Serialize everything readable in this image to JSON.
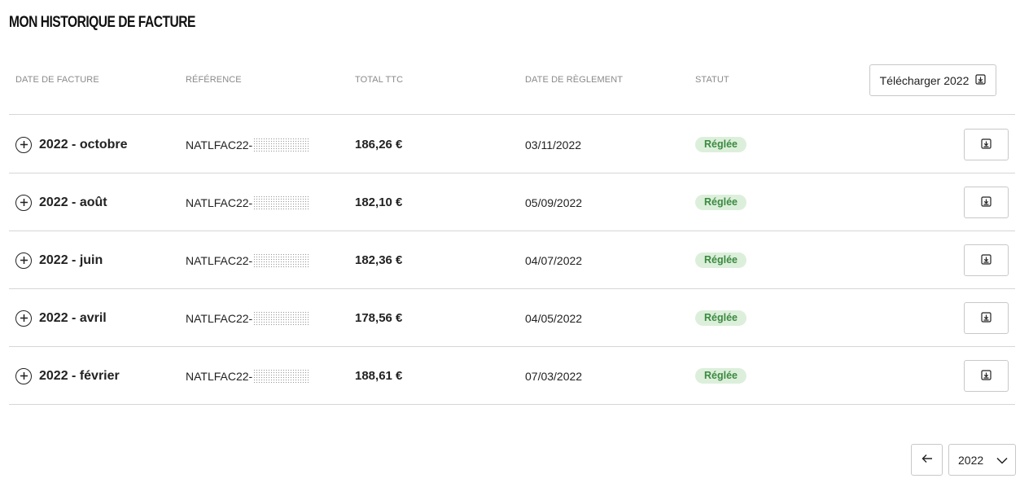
{
  "page": {
    "title": "MON HISTORIQUE DE FACTURE"
  },
  "table": {
    "headers": {
      "invoice_date": "DATE DE FACTURE",
      "reference": "RÉFÉRENCE",
      "total": "TOTAL TTC",
      "settlement_date": "DATE DE RÈGLEMENT",
      "status": "STATUT"
    },
    "download_year_label": "Télécharger 2022",
    "rows": [
      {
        "period": "2022 - octobre",
        "reference_prefix": "NATLFAC22-",
        "total": "186,26 €",
        "settlement_date": "03/11/2022",
        "status": "Réglée"
      },
      {
        "period": "2022 - août",
        "reference_prefix": "NATLFAC22-",
        "total": "182,10 €",
        "settlement_date": "05/09/2022",
        "status": "Réglée"
      },
      {
        "period": "2022 - juin",
        "reference_prefix": "NATLFAC22-",
        "total": "182,36 €",
        "settlement_date": "04/07/2022",
        "status": "Réglée"
      },
      {
        "period": "2022 - avril",
        "reference_prefix": "NATLFAC22-",
        "total": "178,56 €",
        "settlement_date": "04/05/2022",
        "status": "Réglée"
      },
      {
        "period": "2022 - février",
        "reference_prefix": "NATLFAC22-",
        "total": "188,61 €",
        "settlement_date": "07/03/2022",
        "status": "Réglée"
      }
    ]
  },
  "pagination": {
    "prev_icon": "arrow-left-icon",
    "selected_year": "2022",
    "dropdown_icon": "chevron-down-icon"
  },
  "colors": {
    "status_bg": "#dcefdb",
    "status_text": "#3b8a40",
    "divider": "#d6d6d6"
  }
}
